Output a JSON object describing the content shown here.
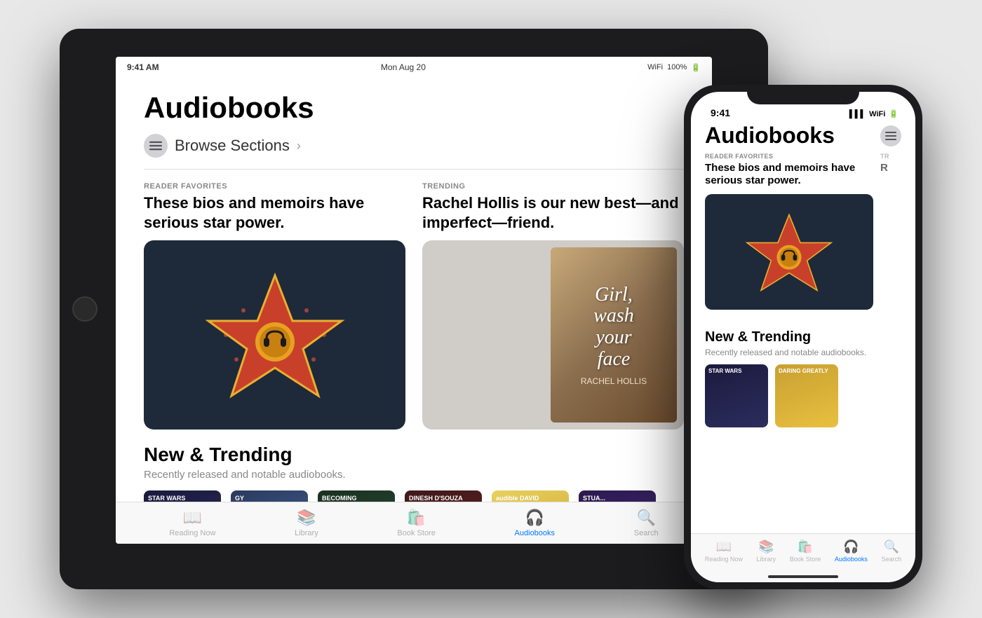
{
  "ipad": {
    "status_bar": {
      "time": "9:41 AM",
      "date": "Mon Aug 20",
      "wifi": "WiFi",
      "battery": "100%"
    },
    "title": "Audiobooks",
    "browse_sections": "Browse Sections",
    "sections": [
      {
        "category": "READER FAVORITES",
        "title": "These bios and memoirs have serious star power.",
        "type": "star"
      },
      {
        "category": "TRENDING",
        "title": "Rachel Hollis is our new best—and imperfect—friend.",
        "type": "book_cover",
        "book_title": "Girl, wash your face",
        "book_author": "RACHEL HOLLIS"
      }
    ],
    "new_trending": {
      "title": "New & Trending",
      "subtitle": "Recently released and notable audiobooks."
    },
    "tabs": [
      {
        "label": "Reading Now",
        "icon": "📖",
        "active": false
      },
      {
        "label": "Library",
        "icon": "📚",
        "active": false
      },
      {
        "label": "Book Store",
        "icon": "🛍️",
        "active": false
      },
      {
        "label": "Audiobooks",
        "icon": "🎧",
        "active": true
      },
      {
        "label": "Search",
        "icon": "🔍",
        "active": false
      }
    ]
  },
  "iphone": {
    "status_bar": {
      "time": "9:41",
      "signal": "▌▌▌",
      "wifi": "WiFi",
      "battery": "■"
    },
    "title": "Audiobooks",
    "sections": [
      {
        "category": "READER FAVORITES",
        "title": "These bios and memoirs have serious star power.",
        "type": "star"
      },
      {
        "category": "TR",
        "title": "R",
        "type": "partial"
      }
    ],
    "new_trending": {
      "title": "New & Trending",
      "subtitle": "Recently released and notable audiobooks."
    },
    "tabs": [
      {
        "label": "Reading Now",
        "icon": "📖",
        "active": false
      },
      {
        "label": "Library",
        "icon": "📚",
        "active": false
      },
      {
        "label": "Book Store",
        "icon": "🛍️",
        "active": false
      },
      {
        "label": "Audiobooks",
        "icon": "🎧",
        "active": true
      },
      {
        "label": "Search",
        "icon": "🔍",
        "active": false
      }
    ]
  }
}
